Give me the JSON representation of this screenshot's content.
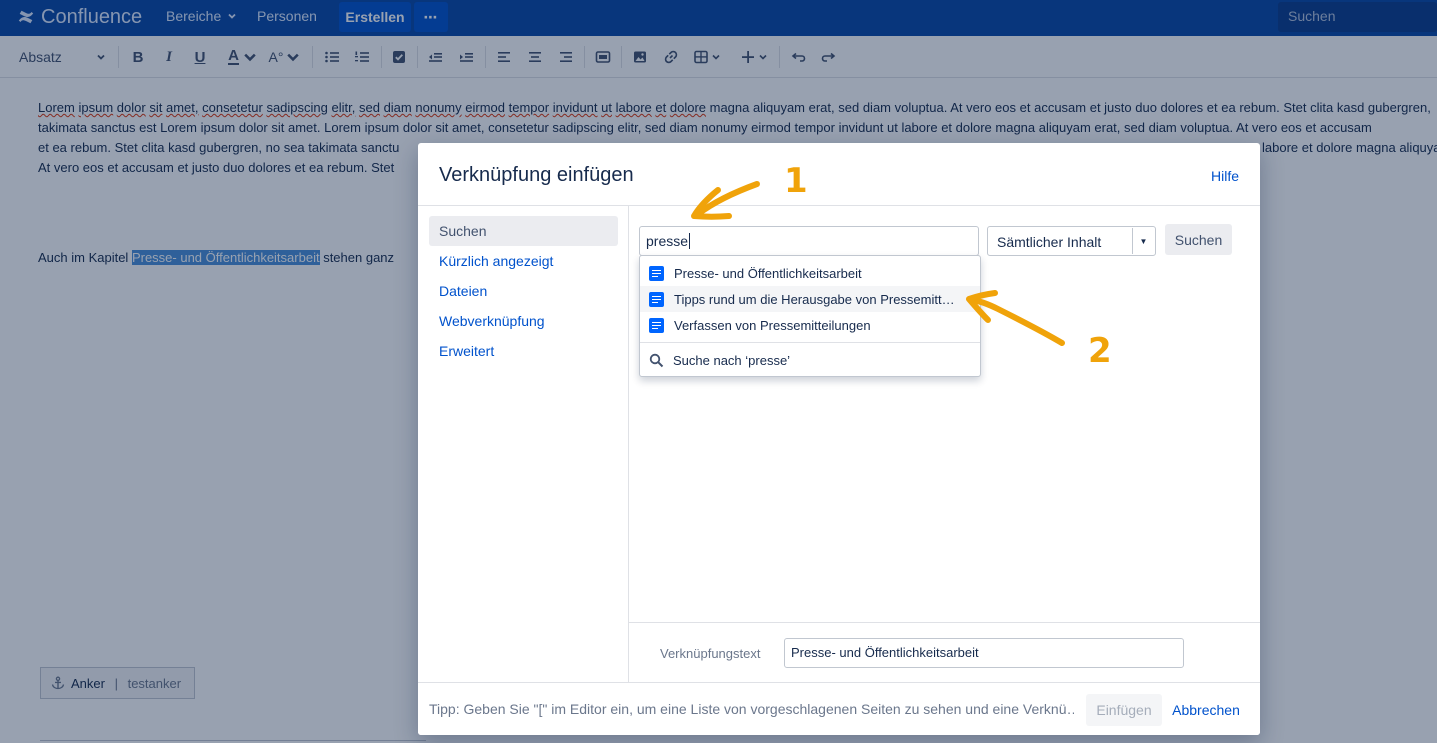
{
  "nav": {
    "logo": "Confluence",
    "spaces": "Bereiche",
    "people": "Personen",
    "create": "Erstellen",
    "more": "⋯",
    "search_placeholder": "Suchen"
  },
  "toolbar": {
    "format": "Absatz"
  },
  "editor": {
    "lines": [
      "magna aliquyam erat, sed diam voluptua. At vero eos et accusam et justo duo dolores et ea rebum. Stet clita kasd gubergren,",
      "takimata sanctus est Lorem ipsum dolor sit amet. Lorem ipsum dolor sit amet, consetetur sadipscing elitr, sed diam nonumy eirmod tempor invidunt ut labore et dolore magna aliquyam erat, sed diam voluptua. At vero eos et accusam",
      "et ea rebum. Stet clita kasd gubergren, no sea takimata sanctu",
      "At vero eos et accusam et justo duo dolores et ea rebum. Stet"
    ],
    "line1_spell": [
      "Lorem",
      "ipsum",
      "dolor",
      "sit",
      "amet,",
      "consetetur",
      "sadipscing",
      "elitr,",
      "sed",
      "diam",
      "nonumy",
      "eirmod",
      "tempor",
      "invidunt",
      "ut",
      "labore",
      "et",
      "dolore"
    ],
    "line3_right": "labore et dolore magna aliquyam",
    "chapter_prefix": "Auch im Kapitel ",
    "chapter_link": "Presse- und Öffentlichkeitsarbeit",
    "chapter_suffix": " stehen ganz",
    "anchor_label": "Anker",
    "anchor_sep": " | ",
    "anchor_name": "testanker"
  },
  "dialog": {
    "title": "Verknüpfung einfügen",
    "help": "Hilfe",
    "nav": [
      "Suchen",
      "Kürzlich angezeigt",
      "Dateien",
      "Webverknüpfung",
      "Erweitert"
    ],
    "search_value": "presse",
    "scope": "Sämtlicher Inhalt",
    "search_button": "Suchen",
    "results": [
      "Presse- und Öffentlichkeitsarbeit",
      "Tipps rund um die Herausgabe von Pressemitt…",
      "Verfassen von Pressemitteilungen"
    ],
    "search_for": "Suche nach ‘presse’",
    "link_text_label": "Verknüpfungstext",
    "link_text_value": "Presse- und Öffentlichkeitsarbeit",
    "tip": "Tipp: Geben Sie \"[\" im Editor ein, um eine Liste von vorgeschlagenen Seiten zu sehen und eine Verknü…",
    "insert": "Einfügen",
    "cancel": "Abbrechen"
  },
  "annotations": {
    "color": "#f0a30a",
    "labels": [
      "1",
      "2"
    ]
  }
}
